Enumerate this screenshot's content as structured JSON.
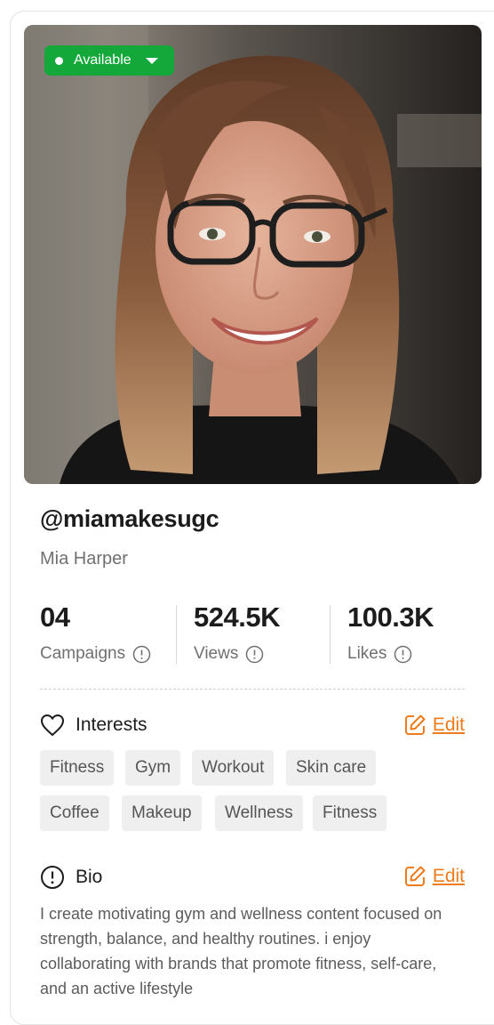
{
  "profile": {
    "status": "Available",
    "handle": "@miamakesugc",
    "name": "Mia Harper",
    "photo_subject": "woman with glasses"
  },
  "stats": [
    {
      "value": "04",
      "label": "Campaigns"
    },
    {
      "value": "524.5K",
      "label": "Views"
    },
    {
      "value": "100.3K",
      "label": "Likes"
    }
  ],
  "interests": {
    "title": "Interests",
    "edit_label": "Edit",
    "tags": [
      "Fitness",
      "Gym",
      "Workout",
      "Skin care",
      "Coffee",
      "Makeup",
      "Wellness",
      "Fitness"
    ]
  },
  "bio": {
    "title": "Bio",
    "edit_label": "Edit",
    "text": "I create motivating gym and wellness content focused on strength, balance, and healthy routines. i enjoy collaborating with brands that promote fitness, self-care, and an active lifestyle"
  },
  "colors": {
    "status_green": "#14a83b",
    "accent_orange": "#f07b1c",
    "tag_bg": "#efefef"
  },
  "icons": [
    "info-icon",
    "heart-icon",
    "alert-circle-icon",
    "edit-icon",
    "chevron-down-icon"
  ]
}
